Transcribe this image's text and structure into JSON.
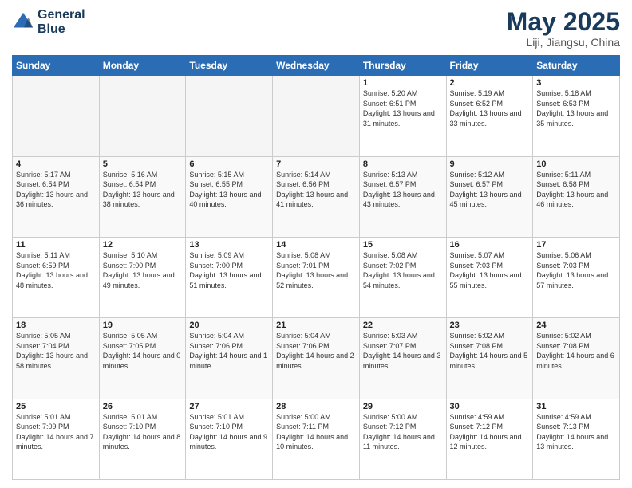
{
  "header": {
    "logo_line1": "General",
    "logo_line2": "Blue",
    "month": "May 2025",
    "location": "Liji, Jiangsu, China"
  },
  "weekdays": [
    "Sunday",
    "Monday",
    "Tuesday",
    "Wednesday",
    "Thursday",
    "Friday",
    "Saturday"
  ],
  "weeks": [
    [
      {
        "day": "",
        "empty": true
      },
      {
        "day": "",
        "empty": true
      },
      {
        "day": "",
        "empty": true
      },
      {
        "day": "",
        "empty": true
      },
      {
        "day": "1",
        "sunrise": "5:20 AM",
        "sunset": "6:51 PM",
        "daylight": "13 hours and 31 minutes."
      },
      {
        "day": "2",
        "sunrise": "5:19 AM",
        "sunset": "6:52 PM",
        "daylight": "13 hours and 33 minutes."
      },
      {
        "day": "3",
        "sunrise": "5:18 AM",
        "sunset": "6:53 PM",
        "daylight": "13 hours and 35 minutes."
      }
    ],
    [
      {
        "day": "4",
        "sunrise": "5:17 AM",
        "sunset": "6:54 PM",
        "daylight": "13 hours and 36 minutes."
      },
      {
        "day": "5",
        "sunrise": "5:16 AM",
        "sunset": "6:54 PM",
        "daylight": "13 hours and 38 minutes."
      },
      {
        "day": "6",
        "sunrise": "5:15 AM",
        "sunset": "6:55 PM",
        "daylight": "13 hours and 40 minutes."
      },
      {
        "day": "7",
        "sunrise": "5:14 AM",
        "sunset": "6:56 PM",
        "daylight": "13 hours and 41 minutes."
      },
      {
        "day": "8",
        "sunrise": "5:13 AM",
        "sunset": "6:57 PM",
        "daylight": "13 hours and 43 minutes."
      },
      {
        "day": "9",
        "sunrise": "5:12 AM",
        "sunset": "6:57 PM",
        "daylight": "13 hours and 45 minutes."
      },
      {
        "day": "10",
        "sunrise": "5:11 AM",
        "sunset": "6:58 PM",
        "daylight": "13 hours and 46 minutes."
      }
    ],
    [
      {
        "day": "11",
        "sunrise": "5:11 AM",
        "sunset": "6:59 PM",
        "daylight": "13 hours and 48 minutes."
      },
      {
        "day": "12",
        "sunrise": "5:10 AM",
        "sunset": "7:00 PM",
        "daylight": "13 hours and 49 minutes."
      },
      {
        "day": "13",
        "sunrise": "5:09 AM",
        "sunset": "7:00 PM",
        "daylight": "13 hours and 51 minutes."
      },
      {
        "day": "14",
        "sunrise": "5:08 AM",
        "sunset": "7:01 PM",
        "daylight": "13 hours and 52 minutes."
      },
      {
        "day": "15",
        "sunrise": "5:08 AM",
        "sunset": "7:02 PM",
        "daylight": "13 hours and 54 minutes."
      },
      {
        "day": "16",
        "sunrise": "5:07 AM",
        "sunset": "7:03 PM",
        "daylight": "13 hours and 55 minutes."
      },
      {
        "day": "17",
        "sunrise": "5:06 AM",
        "sunset": "7:03 PM",
        "daylight": "13 hours and 57 minutes."
      }
    ],
    [
      {
        "day": "18",
        "sunrise": "5:05 AM",
        "sunset": "7:04 PM",
        "daylight": "13 hours and 58 minutes."
      },
      {
        "day": "19",
        "sunrise": "5:05 AM",
        "sunset": "7:05 PM",
        "daylight": "14 hours and 0 minutes."
      },
      {
        "day": "20",
        "sunrise": "5:04 AM",
        "sunset": "7:06 PM",
        "daylight": "14 hours and 1 minute."
      },
      {
        "day": "21",
        "sunrise": "5:04 AM",
        "sunset": "7:06 PM",
        "daylight": "14 hours and 2 minutes."
      },
      {
        "day": "22",
        "sunrise": "5:03 AM",
        "sunset": "7:07 PM",
        "daylight": "14 hours and 3 minutes."
      },
      {
        "day": "23",
        "sunrise": "5:02 AM",
        "sunset": "7:08 PM",
        "daylight": "14 hours and 5 minutes."
      },
      {
        "day": "24",
        "sunrise": "5:02 AM",
        "sunset": "7:08 PM",
        "daylight": "14 hours and 6 minutes."
      }
    ],
    [
      {
        "day": "25",
        "sunrise": "5:01 AM",
        "sunset": "7:09 PM",
        "daylight": "14 hours and 7 minutes."
      },
      {
        "day": "26",
        "sunrise": "5:01 AM",
        "sunset": "7:10 PM",
        "daylight": "14 hours and 8 minutes."
      },
      {
        "day": "27",
        "sunrise": "5:01 AM",
        "sunset": "7:10 PM",
        "daylight": "14 hours and 9 minutes."
      },
      {
        "day": "28",
        "sunrise": "5:00 AM",
        "sunset": "7:11 PM",
        "daylight": "14 hours and 10 minutes."
      },
      {
        "day": "29",
        "sunrise": "5:00 AM",
        "sunset": "7:12 PM",
        "daylight": "14 hours and 11 minutes."
      },
      {
        "day": "30",
        "sunrise": "4:59 AM",
        "sunset": "7:12 PM",
        "daylight": "14 hours and 12 minutes."
      },
      {
        "day": "31",
        "sunrise": "4:59 AM",
        "sunset": "7:13 PM",
        "daylight": "14 hours and 13 minutes."
      }
    ]
  ]
}
